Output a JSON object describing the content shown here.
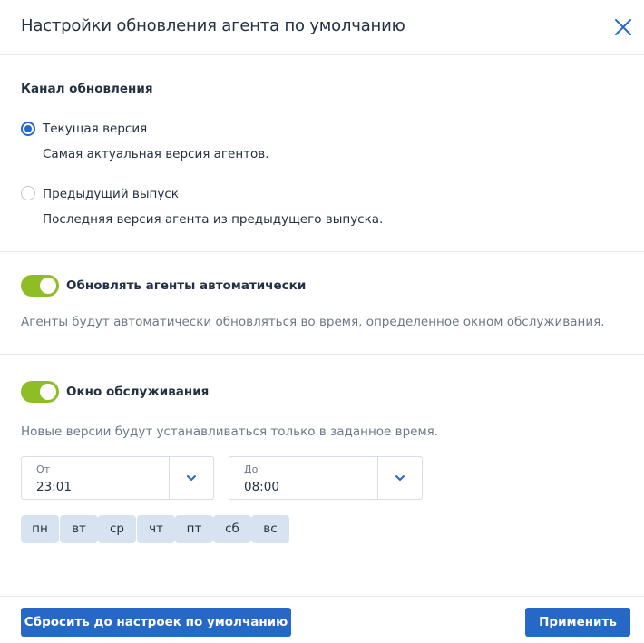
{
  "dialog": {
    "title": "Настройки обновления агента по умолчанию"
  },
  "update_channel": {
    "heading": "Канал обновления",
    "options": [
      {
        "label": "Текущая версия",
        "description": "Самая актуальная версия агентов.",
        "selected": true
      },
      {
        "label": "Предыдущий выпуск",
        "description": "Последняя версия агента из предыдущего выпуска.",
        "selected": false
      }
    ]
  },
  "auto_update": {
    "label": "Обновлять агенты автоматически",
    "enabled": true,
    "description": "Агенты будут автоматически обновляться во время, определенное окном обслуживания."
  },
  "maintenance_window": {
    "label": "Окно обслуживания",
    "enabled": true,
    "description": "Новые версии будут устанавливаться только в заданное время.",
    "from": {
      "caption": "От",
      "value": "23:01"
    },
    "to": {
      "caption": "До",
      "value": "08:00"
    },
    "days": [
      "пн",
      "вт",
      "ср",
      "чт",
      "пт",
      "сб",
      "вс"
    ]
  },
  "footer": {
    "reset_label": "Сбросить до настроек по умолчанию",
    "apply_label": "Применить"
  },
  "colors": {
    "accent": "#2668c5",
    "toggle_on": "#8fbd26",
    "day_chip": "#d8e3f2",
    "text": "#243143",
    "muted": "#6c7888"
  },
  "icons": {
    "close": "close-icon",
    "dropdown": "chevron-down-icon"
  }
}
